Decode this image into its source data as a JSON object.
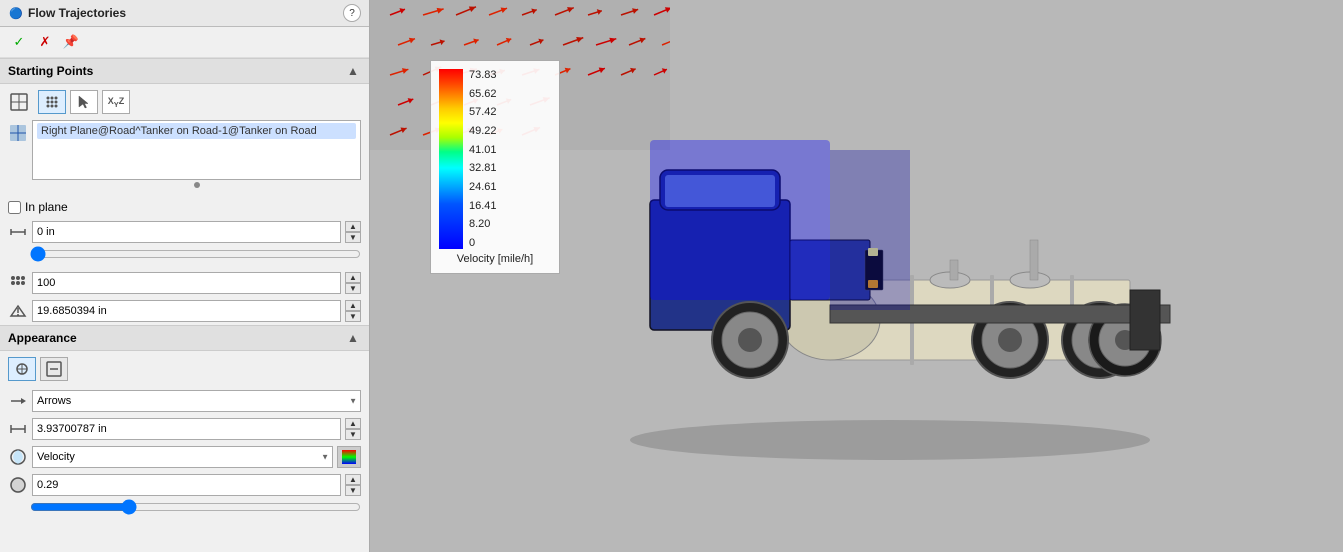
{
  "window": {
    "title": "Flow Trajectories",
    "help_label": "?"
  },
  "toolbar": {
    "confirm_label": "✓",
    "cancel_label": "✗",
    "pin_label": "📌"
  },
  "starting_points": {
    "section_label": "Starting Points",
    "icon1_label": "⊞",
    "icon2_label": "↖",
    "icon3_label": "XYZ",
    "plane_icon": "▣",
    "list_item": "Right Plane@Road^Tanker on Road-1@Tanker on Road",
    "checkbox_label": "In plane",
    "distance_value": "0 in",
    "slider_value": "0",
    "count_value": "100",
    "result_value": "19.6850394 in"
  },
  "appearance": {
    "section_label": "Appearance",
    "icon1_label": "⊹",
    "icon2_label": "⊞",
    "type_value": "Arrows",
    "size_value": "3.93700787 in",
    "color_by_value": "Velocity",
    "opacity_value": "0.29"
  },
  "legend": {
    "values": [
      "73.83",
      "65.62",
      "57.42",
      "49.22",
      "41.01",
      "32.81",
      "24.61",
      "16.41",
      "8.20",
      "0"
    ],
    "unit_label": "Velocity [mile/h]"
  }
}
